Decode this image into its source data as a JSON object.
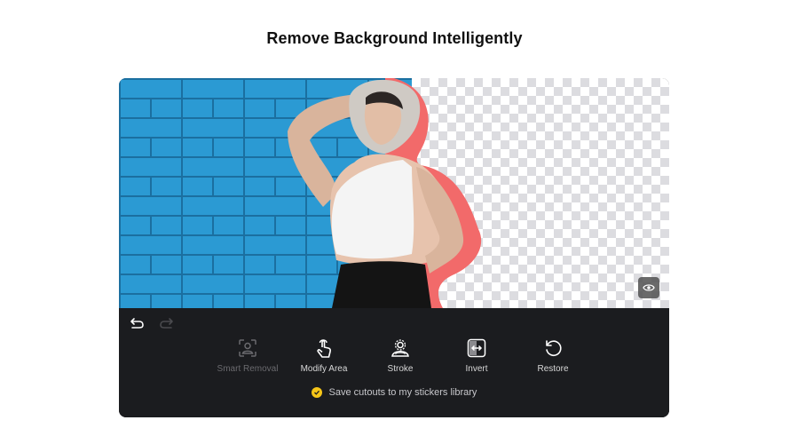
{
  "header": {
    "title": "Remove Background Intelligently"
  },
  "colors": {
    "accent": "#f5c518",
    "stroke": "#f26a6a",
    "wall": "#2b9ad3",
    "panel": "#1b1c1f"
  },
  "canvas": {
    "preview_button_icon": "eye-icon"
  },
  "history": {
    "undo_icon": "undo-icon",
    "redo_icon": "redo-icon",
    "redo_enabled": false
  },
  "tools": [
    {
      "label": "Smart Removal",
      "icon": "person-scan-icon",
      "enabled": false
    },
    {
      "label": "Modify Area",
      "icon": "hand-pointer-icon",
      "enabled": true
    },
    {
      "label": "Stroke",
      "icon": "person-outline-icon",
      "enabled": true
    },
    {
      "label": "Invert",
      "icon": "invert-icon",
      "enabled": true
    },
    {
      "label": "Restore",
      "icon": "restore-icon",
      "enabled": true
    }
  ],
  "save_option": {
    "label": "Save cutouts to my stickers library",
    "checked": true
  }
}
